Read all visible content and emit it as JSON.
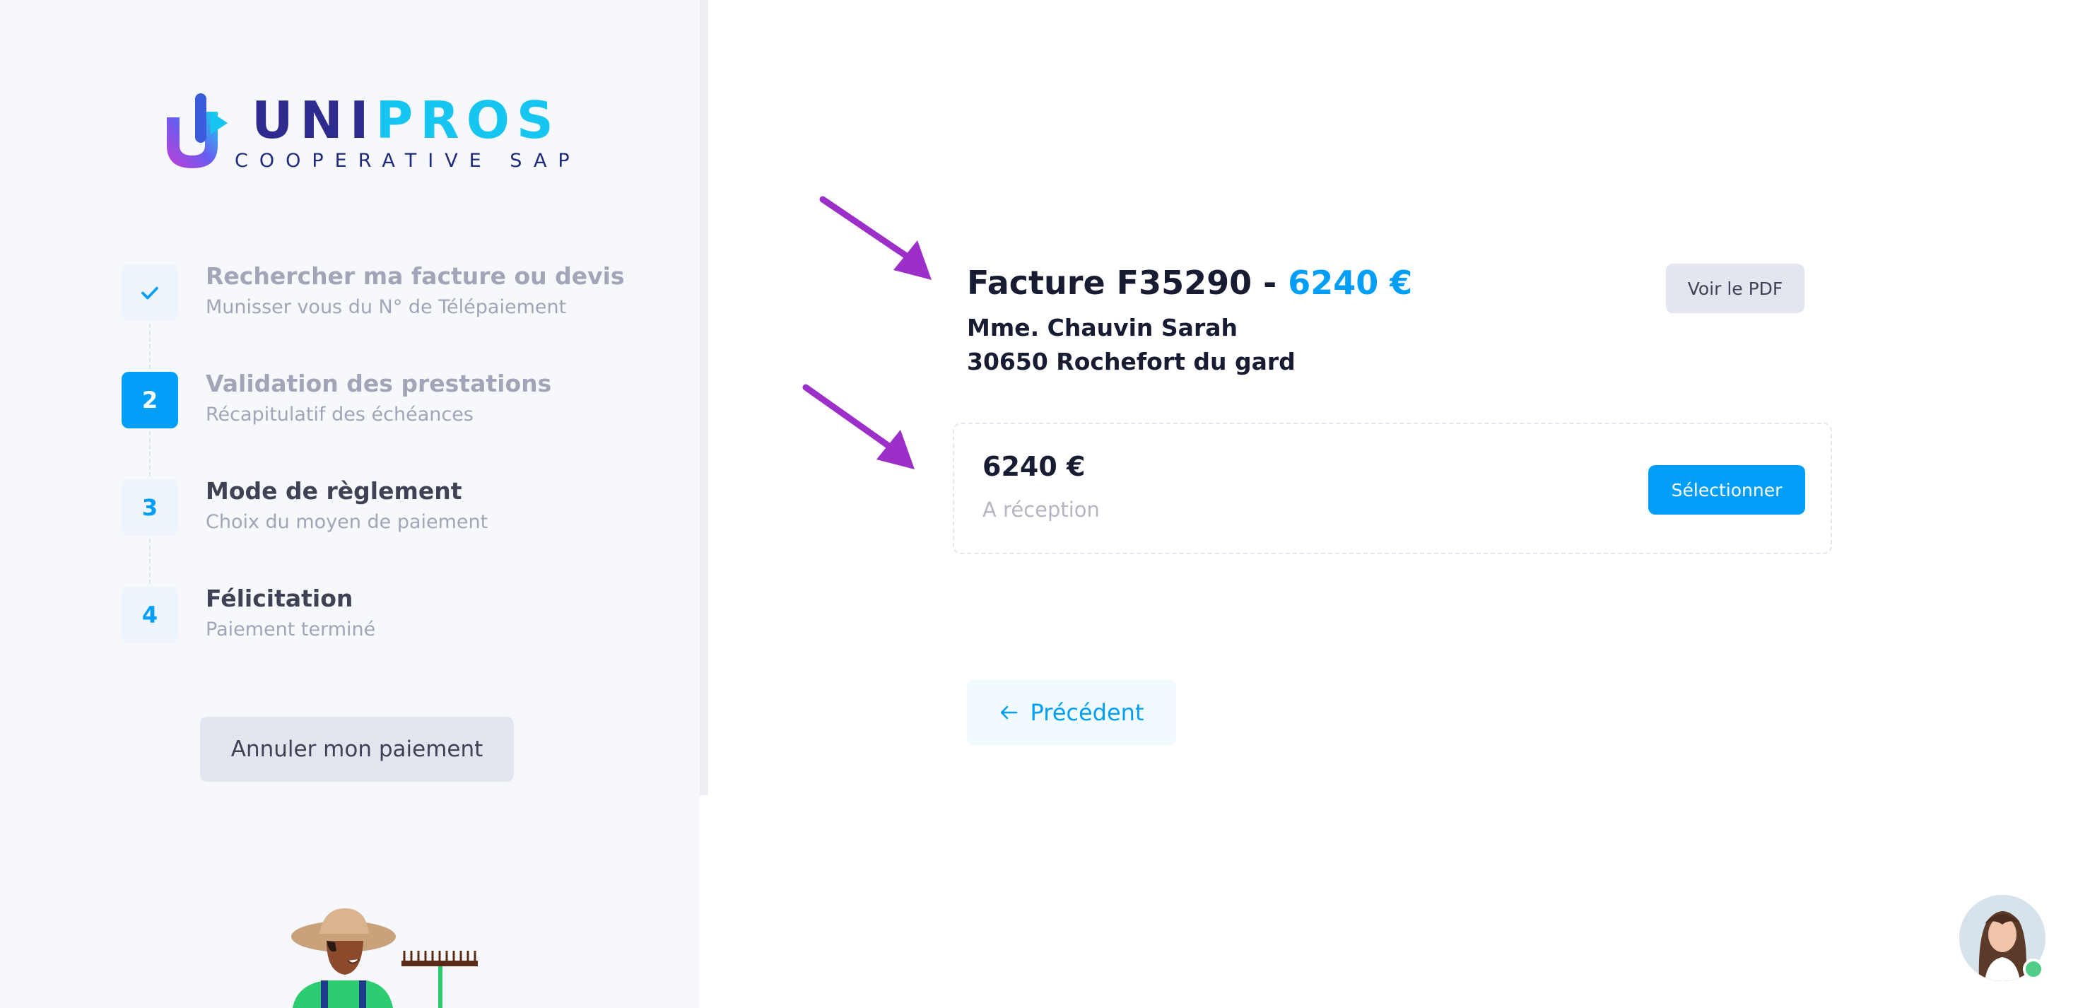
{
  "brand": {
    "name_part1": "UNI",
    "name_part2": "PROS",
    "tagline": "COOPERATIVE SAP",
    "colors": {
      "primary": "#2e2a8e",
      "accent": "#16c6f0",
      "logo_gradient": [
        "#b24be0",
        "#16c6f0"
      ]
    }
  },
  "steps": [
    {
      "marker": "check-icon",
      "title": "Rechercher ma facture ou devis",
      "subtitle": "Munisser vous du N° de Télépaiement",
      "state": "done"
    },
    {
      "marker": "2",
      "title": "Validation des prestations",
      "subtitle": "Récapitulatif des échéances",
      "state": "current"
    },
    {
      "marker": "3",
      "title": "Mode de règlement",
      "subtitle": "Choix du moyen de paiement",
      "state": "pending"
    },
    {
      "marker": "4",
      "title": "Félicitation",
      "subtitle": "Paiement terminé",
      "state": "pending"
    }
  ],
  "sidebar": {
    "cancel_label": "Annuler mon paiement"
  },
  "invoice": {
    "title_prefix": "Facture F35290 -",
    "amount": "6240 €",
    "client_name": "Mme. Chauvin Sarah",
    "client_city": "30650 Rochefort du gard",
    "pdf_label": "Voir le PDF"
  },
  "payment_option": {
    "amount": "6240 €",
    "term": "A réception",
    "select_label": "Sélectionner"
  },
  "navigation": {
    "previous_label": "Précédent"
  },
  "colors": {
    "primary": "#009ef7",
    "annotation_arrow": "#9b2fc7",
    "online_status": "#50cd89"
  }
}
